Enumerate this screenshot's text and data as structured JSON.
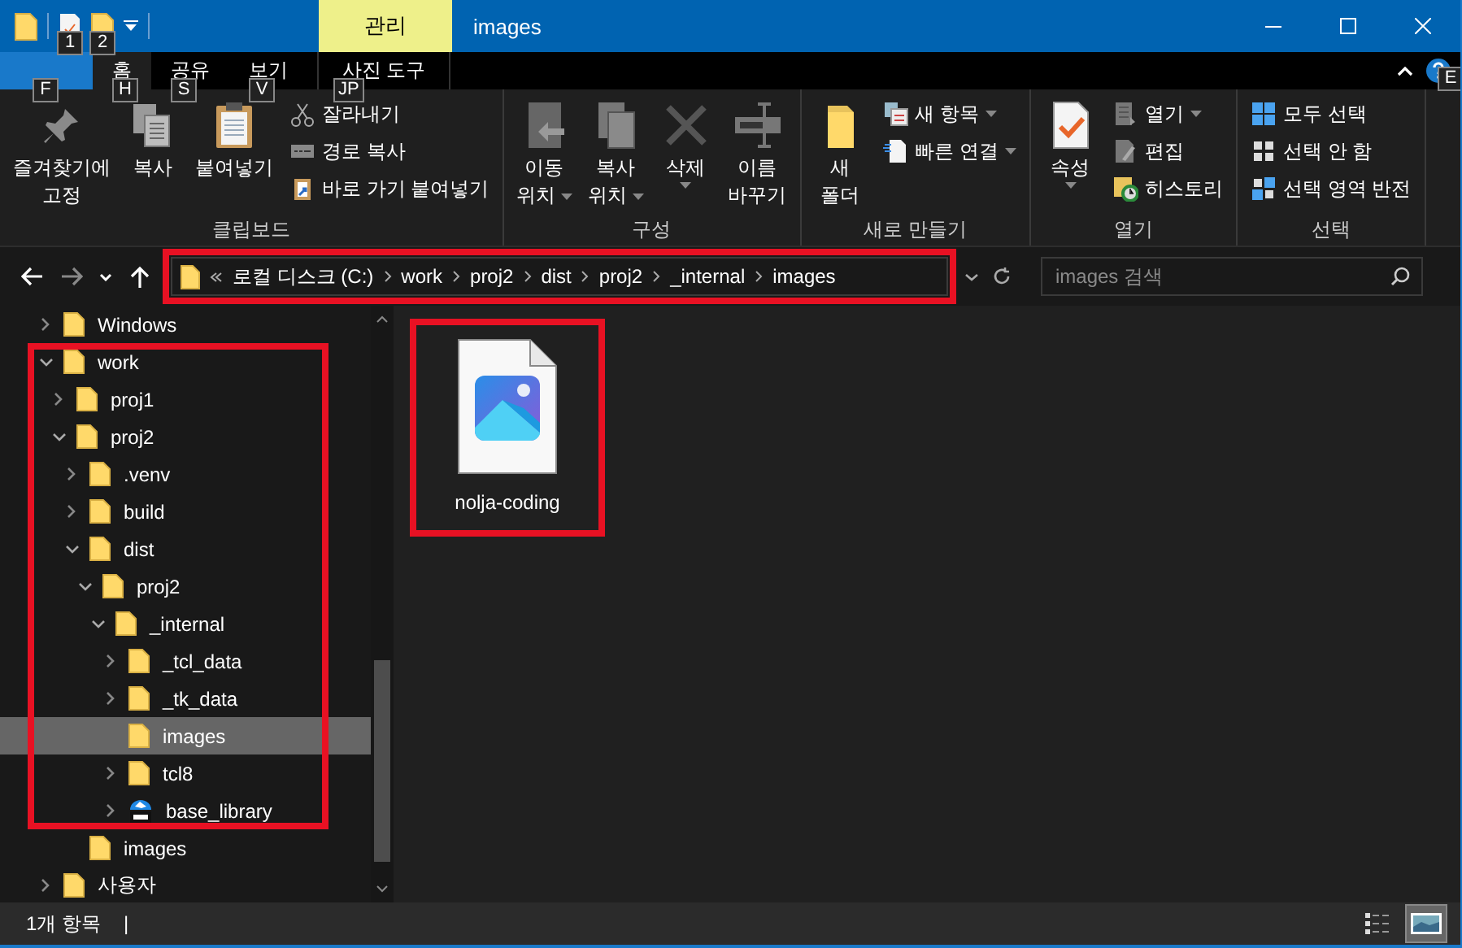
{
  "window": {
    "title": "images",
    "context_group": "관리",
    "quick_access_key_tips": [
      "1",
      "2"
    ]
  },
  "tabs": [
    {
      "kind": "file",
      "key_tip": "F",
      "selected": false
    },
    {
      "kind": "normal",
      "label": "홈",
      "key_tip": "H",
      "selected": true
    },
    {
      "kind": "normal",
      "label": "공유",
      "key_tip": "S",
      "selected": false
    },
    {
      "kind": "normal",
      "label": "보기",
      "key_tip": "V",
      "selected": false
    },
    {
      "kind": "context",
      "label": "사진 도구",
      "key_tip": "JP",
      "selected": false
    }
  ],
  "help": {
    "key_tip": "E"
  },
  "ribbon": {
    "groups": [
      {
        "label": "클립보드",
        "items": [
          {
            "kind": "large",
            "lines": [
              "즐겨찾기에",
              "고정"
            ],
            "dropdown": false
          },
          {
            "kind": "large",
            "lines": [
              "복사"
            ],
            "dropdown": false
          },
          {
            "kind": "large",
            "lines": [
              "붙여넣기"
            ],
            "dropdown": false
          },
          {
            "kind": "small",
            "lines": [
              "잘라내기"
            ],
            "dropdown": false
          },
          {
            "kind": "small",
            "lines": [
              "경로 복사"
            ],
            "dropdown": false
          },
          {
            "kind": "small",
            "lines": [
              "바로 가기 붙여넣기"
            ],
            "dropdown": false
          }
        ]
      },
      {
        "label": "구성",
        "items": [
          {
            "kind": "large",
            "lines": [
              "이동",
              "위치"
            ],
            "dropdown": true
          },
          {
            "kind": "large",
            "lines": [
              "복사",
              "위치"
            ],
            "dropdown": true
          },
          {
            "kind": "large",
            "lines": [
              "삭제"
            ],
            "dropdown": true
          },
          {
            "kind": "large",
            "lines": [
              "이름",
              "바꾸기"
            ],
            "dropdown": false
          }
        ]
      },
      {
        "label": "새로 만들기",
        "items": [
          {
            "kind": "large",
            "lines": [
              "새",
              "폴더"
            ],
            "dropdown": false
          },
          {
            "kind": "small",
            "lines": [
              "새 항목"
            ],
            "dropdown": true
          },
          {
            "kind": "small",
            "lines": [
              "빠른 연결"
            ],
            "dropdown": true
          }
        ]
      },
      {
        "label": "열기",
        "items": [
          {
            "kind": "large",
            "lines": [
              "속성"
            ],
            "dropdown": true
          },
          {
            "kind": "small",
            "lines": [
              "열기"
            ],
            "dropdown": true
          },
          {
            "kind": "small",
            "lines": [
              "편집"
            ],
            "dropdown": false
          },
          {
            "kind": "small",
            "lines": [
              "히스토리"
            ],
            "dropdown": false
          }
        ]
      },
      {
        "label": "선택",
        "items": [
          {
            "kind": "small",
            "lines": [
              "모두 선택"
            ],
            "dropdown": false
          },
          {
            "kind": "small",
            "lines": [
              "선택 안 함"
            ],
            "dropdown": false
          },
          {
            "kind": "small",
            "lines": [
              "선택 영역 반전"
            ],
            "dropdown": false
          }
        ]
      }
    ]
  },
  "address_bar": {
    "highlighted": true,
    "crumbs": [
      "로컬 디스크 (C:)",
      "work",
      "proj2",
      "dist",
      "proj2",
      "_internal",
      "images"
    ]
  },
  "search": {
    "placeholder": "images 검색"
  },
  "tree": [
    {
      "label": "Windows",
      "kind": "folder",
      "has_children": true,
      "expanded": false,
      "selected": false,
      "highlighted": false
    },
    {
      "label": "work",
      "kind": "folder",
      "has_children": true,
      "expanded": true,
      "selected": false,
      "highlighted": true,
      "children": [
        {
          "label": "proj1",
          "kind": "folder",
          "has_children": true,
          "expanded": false,
          "selected": false,
          "highlighted": true
        },
        {
          "label": "proj2",
          "kind": "folder",
          "has_children": true,
          "expanded": true,
          "selected": false,
          "highlighted": true,
          "children": [
            {
              "label": ".venv",
              "kind": "folder",
              "has_children": true,
              "expanded": false,
              "selected": false,
              "highlighted": true
            },
            {
              "label": "build",
              "kind": "folder",
              "has_children": true,
              "expanded": false,
              "selected": false,
              "highlighted": true
            },
            {
              "label": "dist",
              "kind": "folder",
              "has_children": true,
              "expanded": true,
              "selected": false,
              "highlighted": true,
              "children": [
                {
                  "label": "proj2",
                  "kind": "folder",
                  "has_children": true,
                  "expanded": true,
                  "selected": false,
                  "highlighted": true,
                  "children": [
                    {
                      "label": "_internal",
                      "kind": "folder",
                      "has_children": true,
                      "expanded": true,
                      "selected": false,
                      "highlighted": true,
                      "children": [
                        {
                          "label": "_tcl_data",
                          "kind": "folder",
                          "has_children": true,
                          "expanded": false,
                          "selected": false,
                          "highlighted": true
                        },
                        {
                          "label": "_tk_data",
                          "kind": "folder",
                          "has_children": true,
                          "expanded": false,
                          "selected": false,
                          "highlighted": true
                        },
                        {
                          "label": "images",
                          "kind": "folder",
                          "has_children": false,
                          "expanded": false,
                          "selected": true,
                          "highlighted": true
                        },
                        {
                          "label": "tcl8",
                          "kind": "folder",
                          "has_children": true,
                          "expanded": false,
                          "selected": false,
                          "highlighted": true
                        },
                        {
                          "label": "base_library",
                          "kind": "zip",
                          "has_children": true,
                          "expanded": false,
                          "selected": false,
                          "highlighted": true
                        }
                      ]
                    }
                  ]
                }
              ]
            },
            {
              "label": "images",
              "kind": "folder",
              "has_children": false,
              "expanded": false,
              "selected": false,
              "highlighted": false
            }
          ]
        }
      ]
    },
    {
      "label": "사용자",
      "kind": "folder",
      "has_children": true,
      "expanded": false,
      "selected": false,
      "highlighted": false
    }
  ],
  "files": [
    {
      "name": "nolja-coding",
      "kind": "image",
      "highlighted": true,
      "selected": false
    }
  ],
  "status_bar": {
    "item_count": "1개 항목",
    "separator": "|",
    "views": [
      {
        "kind": "details",
        "selected": false
      },
      {
        "kind": "large_icons",
        "selected": true
      }
    ]
  }
}
